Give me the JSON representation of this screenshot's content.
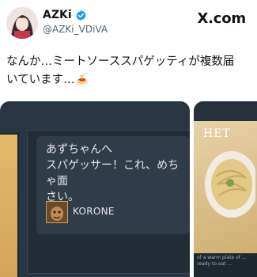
{
  "header": {
    "display_name": "AZKi",
    "handle": "@AZKi_VDiVA",
    "brand": "X.com"
  },
  "tweet": {
    "text": "なんか…ミートソーススパゲッティが複数届いています…🍝"
  },
  "media": {
    "card_text": "あずちゃんへ\nスパゲッサー！これ、めちゃ面\nさい。",
    "sender": "KORONE",
    "side_title": "HET",
    "side_caption": "of a warm plate of ... ready to eat ..."
  },
  "colors": {
    "verified": "#1d9bf0",
    "text": "#0f1419",
    "handle": "#536471",
    "card_bg": "#313c49"
  }
}
